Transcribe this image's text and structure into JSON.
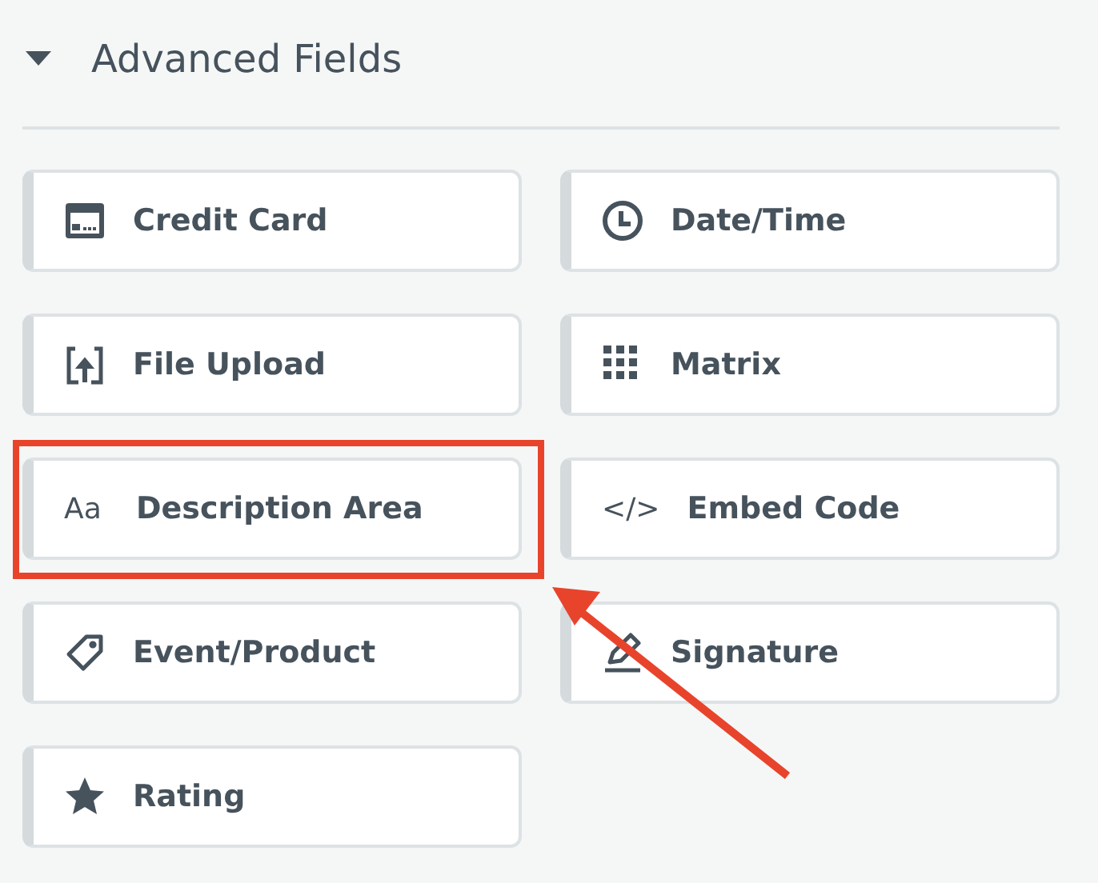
{
  "section": {
    "title": "Advanced Fields",
    "expanded": true
  },
  "fields": [
    {
      "label": "Credit Card",
      "highlighted": false
    },
    {
      "label": "Date/Time",
      "highlighted": false
    },
    {
      "label": "File Upload",
      "highlighted": false
    },
    {
      "label": "Matrix",
      "highlighted": false
    },
    {
      "label": "Description Area",
      "glyph": "Aa",
      "highlighted": true
    },
    {
      "label": "Embed Code",
      "glyph": "</>",
      "highlighted": false
    },
    {
      "label": "Event/Product",
      "highlighted": false
    },
    {
      "label": "Signature",
      "highlighted": false
    },
    {
      "label": "Rating",
      "highlighted": false
    }
  ]
}
